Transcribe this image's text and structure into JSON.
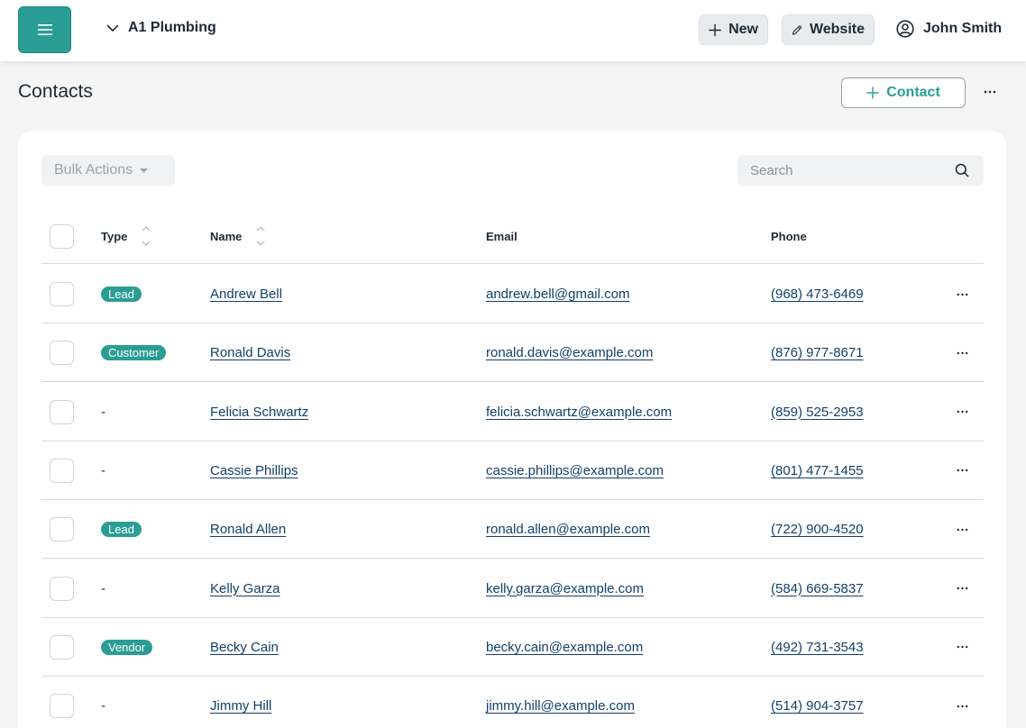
{
  "header": {
    "company": "A1 Plumbing",
    "new_label": "New",
    "website_label": "Website",
    "user_name": "John Smith"
  },
  "page": {
    "title": "Contacts",
    "add_contact_label": "Contact"
  },
  "toolbar": {
    "bulk_actions_label": "Bulk Actions",
    "search_placeholder": "Search"
  },
  "table": {
    "columns": {
      "type": "Type",
      "name": "Name",
      "email": "Email",
      "phone": "Phone"
    },
    "rows": [
      {
        "type": "Lead",
        "name": "Andrew Bell",
        "email": "andrew.bell@gmail.com",
        "phone": "(968) 473-6469"
      },
      {
        "type": "Customer",
        "name": "Ronald Davis",
        "email": "ronald.davis@example.com",
        "phone": "(876) 977-8671"
      },
      {
        "type": "-",
        "name": "Felicia Schwartz",
        "email": "felicia.schwartz@example.com",
        "phone": "(859) 525-2953"
      },
      {
        "type": "-",
        "name": "Cassie Phillips",
        "email": "cassie.phillips@example.com",
        "phone": "(801) 477-1455"
      },
      {
        "type": "Lead",
        "name": "Ronald Allen",
        "email": "ronald.allen@example.com",
        "phone": "(722) 900-4520"
      },
      {
        "type": "-",
        "name": "Kelly Garza",
        "email": "kelly.garza@example.com",
        "phone": "(584) 669-5837"
      },
      {
        "type": "Vendor",
        "name": "Becky Cain",
        "email": "becky.cain@example.com",
        "phone": "(492) 731-3543"
      },
      {
        "type": "-",
        "name": "Jimmy Hill",
        "email": "jimmy.hill@example.com",
        "phone": "(514) 904-3757"
      }
    ]
  },
  "colors": {
    "accent": "#2a9d94",
    "link": "#12406b",
    "background": "#f5f5f5"
  },
  "icons": [
    "hamburger-icon",
    "chevron-down-icon",
    "plus-icon",
    "pencil-icon",
    "user-circle-icon",
    "more-horizontal-icon",
    "caret-down-icon",
    "search-icon",
    "sort-icon"
  ]
}
